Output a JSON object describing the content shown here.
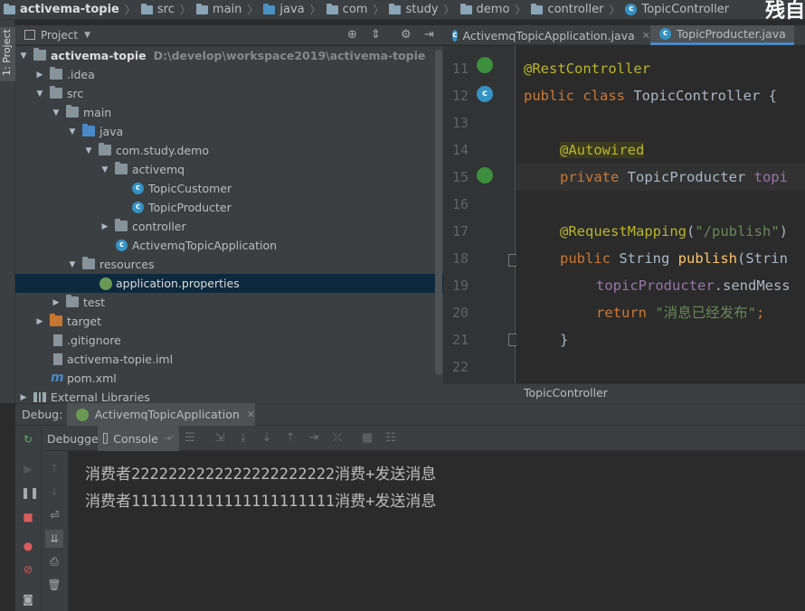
{
  "breadcrumb": {
    "items": [
      "activema-topie",
      "src",
      "main",
      "java",
      "com",
      "study",
      "demo",
      "controller",
      "TopicController"
    ]
  },
  "brand_text": "残自",
  "sidebar": {
    "project_tab": "1: Project"
  },
  "project_panel": {
    "title": "Project",
    "tree": [
      {
        "label": "activema-topie",
        "path": "D:\\develop\\workspace2019\\activema-topie"
      },
      {
        "label": ".idea"
      },
      {
        "label": "src"
      },
      {
        "label": "main"
      },
      {
        "label": "java"
      },
      {
        "label": "com.study.demo"
      },
      {
        "label": "activemq"
      },
      {
        "label": "TopicCustomer"
      },
      {
        "label": "TopicProducter"
      },
      {
        "label": "controller"
      },
      {
        "label": "ActivemqTopicApplication"
      },
      {
        "label": "resources"
      },
      {
        "label": "application.properties"
      },
      {
        "label": "test"
      },
      {
        "label": "target"
      },
      {
        "label": ".gitignore"
      },
      {
        "label": "activema-topie.iml"
      },
      {
        "label": "pom.xml"
      },
      {
        "label": "External Libraries"
      }
    ]
  },
  "editor": {
    "tabs": [
      {
        "label": "ActivemqTopicApplication.java"
      },
      {
        "label": "TopicProducter.java"
      }
    ],
    "line_numbers": [
      "11",
      "12",
      "13",
      "14",
      "15",
      "16",
      "17",
      "18",
      "19",
      "20",
      "21",
      "22"
    ],
    "code": {
      "l11_ann": "@RestController",
      "l12_kw": "public class ",
      "l12_txt": "TopicController {",
      "l14_ann": "@Autowired",
      "l15_kw": "private ",
      "l15_txt": "TopicProducter ",
      "l15_fld": "topi",
      "l17_ann": "@RequestMapping",
      "l17_p1": "(",
      "l17_str": "\"/publish\"",
      "l17_p2": ")",
      "l18_kw": "public ",
      "l18_txt": "String ",
      "l18_fn": "publish",
      "l18_rest": "(Strin",
      "l19_fld": "topicProducter",
      "l19_rest": ".sendMess",
      "l20_kw": "return ",
      "l20_str": "\"消息已经发布\"",
      "l20_end": ";",
      "l21": "}"
    },
    "bottom_crumb": "TopicController"
  },
  "debug": {
    "label": "Debug:",
    "session_tab": "ActivemqTopicApplication",
    "subtabs": {
      "debugger": "Debugger",
      "console": "Console"
    },
    "console_lines": [
      "消费者2222222222222222222222消费+发送消息",
      "消费者1111111111111111111111消费+发送消息"
    ]
  },
  "colors": {
    "panel_bg": "#3c3f41",
    "editor_bg": "#2b2b2b",
    "annotation": "#bbb529",
    "keyword": "#cc7832",
    "string": "#6a8759",
    "field": "#9876aa",
    "selection": "#0d293e"
  }
}
